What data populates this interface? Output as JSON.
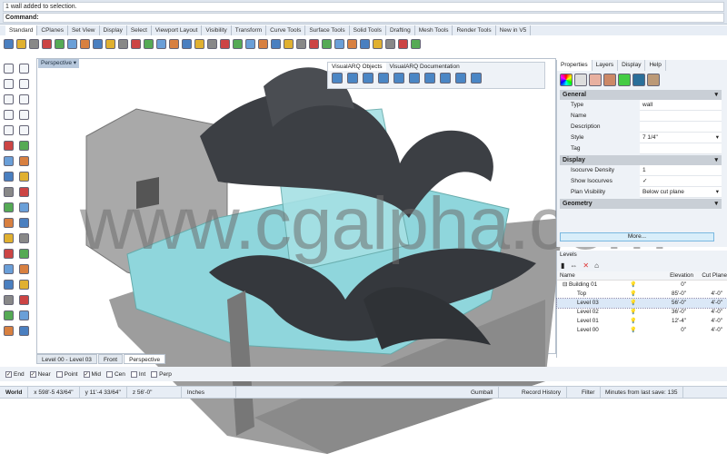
{
  "command": {
    "history": "1 wall added to selection.",
    "prompt": "Command:"
  },
  "toolbar_tabs": [
    "Standard",
    "CPlanes",
    "Set View",
    "Display",
    "Select",
    "Viewport Layout",
    "Visibility",
    "Transform",
    "Curve Tools",
    "Surface Tools",
    "Solid Tools",
    "Drafting",
    "Mesh Tools",
    "Render Tools",
    "New in V5"
  ],
  "toolbar_icons": [
    "new-icon",
    "open-icon",
    "save-icon",
    "print-icon",
    "import-icon",
    "cut-icon",
    "copy-icon",
    "paste-icon",
    "undo-icon",
    "pan-icon",
    "rotate-icon",
    "zoom-icon",
    "zoom-window-icon",
    "zoom-extents-icon",
    "zoom-selected-icon",
    "rotate-view-icon",
    "four-viewports-icon",
    "car-icon",
    "grid-icon",
    "osnap-icon",
    "layer-icon",
    "lightbulb-icon",
    "lock-icon",
    "material-icon",
    "color-wheel-icon",
    "sphere-wireframe-icon",
    "sphere-shaded-icon",
    "sphere-rendered-icon",
    "sphere-render-icon",
    "light-icon",
    "settings-icon",
    "dimension-icon",
    "help-icon"
  ],
  "viewport": {
    "title": "Perspective",
    "tabs": [
      "Level 00 - Level 03",
      "Front",
      "Perspective"
    ]
  },
  "visualarq": {
    "tabs": [
      "VisualARQ Objects",
      "VisualARQ Documentation"
    ],
    "icons": [
      "wall-icon",
      "curtain-wall-icon",
      "slab-icon",
      "column-icon",
      "door-icon",
      "window-icon",
      "beam-icon",
      "railing-icon",
      "roof-icon",
      "stair-icon"
    ]
  },
  "left_toolbar_icons": [
    "select-icon",
    "point-icon",
    "polyline-icon",
    "curve-icon",
    "circle-icon",
    "ellipse-icon",
    "polygon-icon",
    "rectangle-icon",
    "arc-icon",
    "fillet-icon",
    "surface-icon",
    "loft-icon",
    "box-icon",
    "boolean-icon",
    "cylinder-icon",
    "mesh-icon",
    "explode-icon",
    "trim-icon",
    "split-icon",
    "join-icon",
    "group-icon",
    "point-cloud-icon",
    "curve-offset-icon",
    "blend-icon",
    "column-icon",
    "transform-icon",
    "array-icon",
    "align-icon",
    "block-icon",
    "dimension-icon",
    "grid-array-icon",
    "sequence-icon",
    "analyze-icon",
    "check-icon",
    "render-icon",
    "paint-icon"
  ],
  "osnap": [
    {
      "label": "End",
      "checked": true
    },
    {
      "label": "Near",
      "checked": true
    },
    {
      "label": "Point",
      "checked": false
    },
    {
      "label": "Mid",
      "checked": true
    },
    {
      "label": "Cen",
      "checked": false
    },
    {
      "label": "Int",
      "checked": false
    },
    {
      "label": "Perp",
      "checked": false
    }
  ],
  "status": {
    "cplane": "World",
    "x": "x 598'-5 43/64\"",
    "y": "y 11'-4 33/64\"",
    "z": "z 56'-0\"",
    "units": "Inches",
    "gumball": "Gumball",
    "history": "Record History",
    "filter": "Filter",
    "save": "Minutes from last save: 135"
  },
  "properties": {
    "tabs": [
      "Properties",
      "Layers",
      "Display",
      "Help"
    ],
    "sections": {
      "general": {
        "title": "General",
        "rows": [
          {
            "k": "Type",
            "v": "wall"
          },
          {
            "k": "Name",
            "v": ""
          },
          {
            "k": "Description",
            "v": ""
          },
          {
            "k": "Style",
            "v": "7 1/4\""
          },
          {
            "k": "Tag",
            "v": ""
          }
        ]
      },
      "display": {
        "title": "Display",
        "rows": [
          {
            "k": "Isocurve Density",
            "v": "1"
          },
          {
            "k": "Show Isocurves",
            "v": "✓"
          },
          {
            "k": "Plan Visibility",
            "v": "Below cut plane"
          }
        ]
      },
      "geometry": {
        "title": "Geometry"
      }
    },
    "more": "More..."
  },
  "levels": {
    "title": "Levels",
    "columns": [
      "Name",
      "Elevation",
      "Cut Plane"
    ],
    "rows": [
      {
        "name": "⊟ Building 01",
        "elev": "0\"",
        "cut": ""
      },
      {
        "name": "Top",
        "elev": "85'-0\"",
        "cut": "4'-0\""
      },
      {
        "name": "Level 03",
        "elev": "56'-0\"",
        "cut": "4'-0\"",
        "selected": true
      },
      {
        "name": "Level 02",
        "elev": "36'-0\"",
        "cut": "4'-0\""
      },
      {
        "name": "Level 01",
        "elev": "12'-4\"",
        "cut": "4'-0\""
      },
      {
        "name": "Level 00",
        "elev": "0\"",
        "cut": "4'-0\""
      }
    ]
  },
  "watermark": "www.cgalpha.com",
  "colors": {
    "glass": "#8fd6dc",
    "wall": "#a9a9a9",
    "skin": "#3c3f44",
    "accent": "#b7c8dc"
  }
}
